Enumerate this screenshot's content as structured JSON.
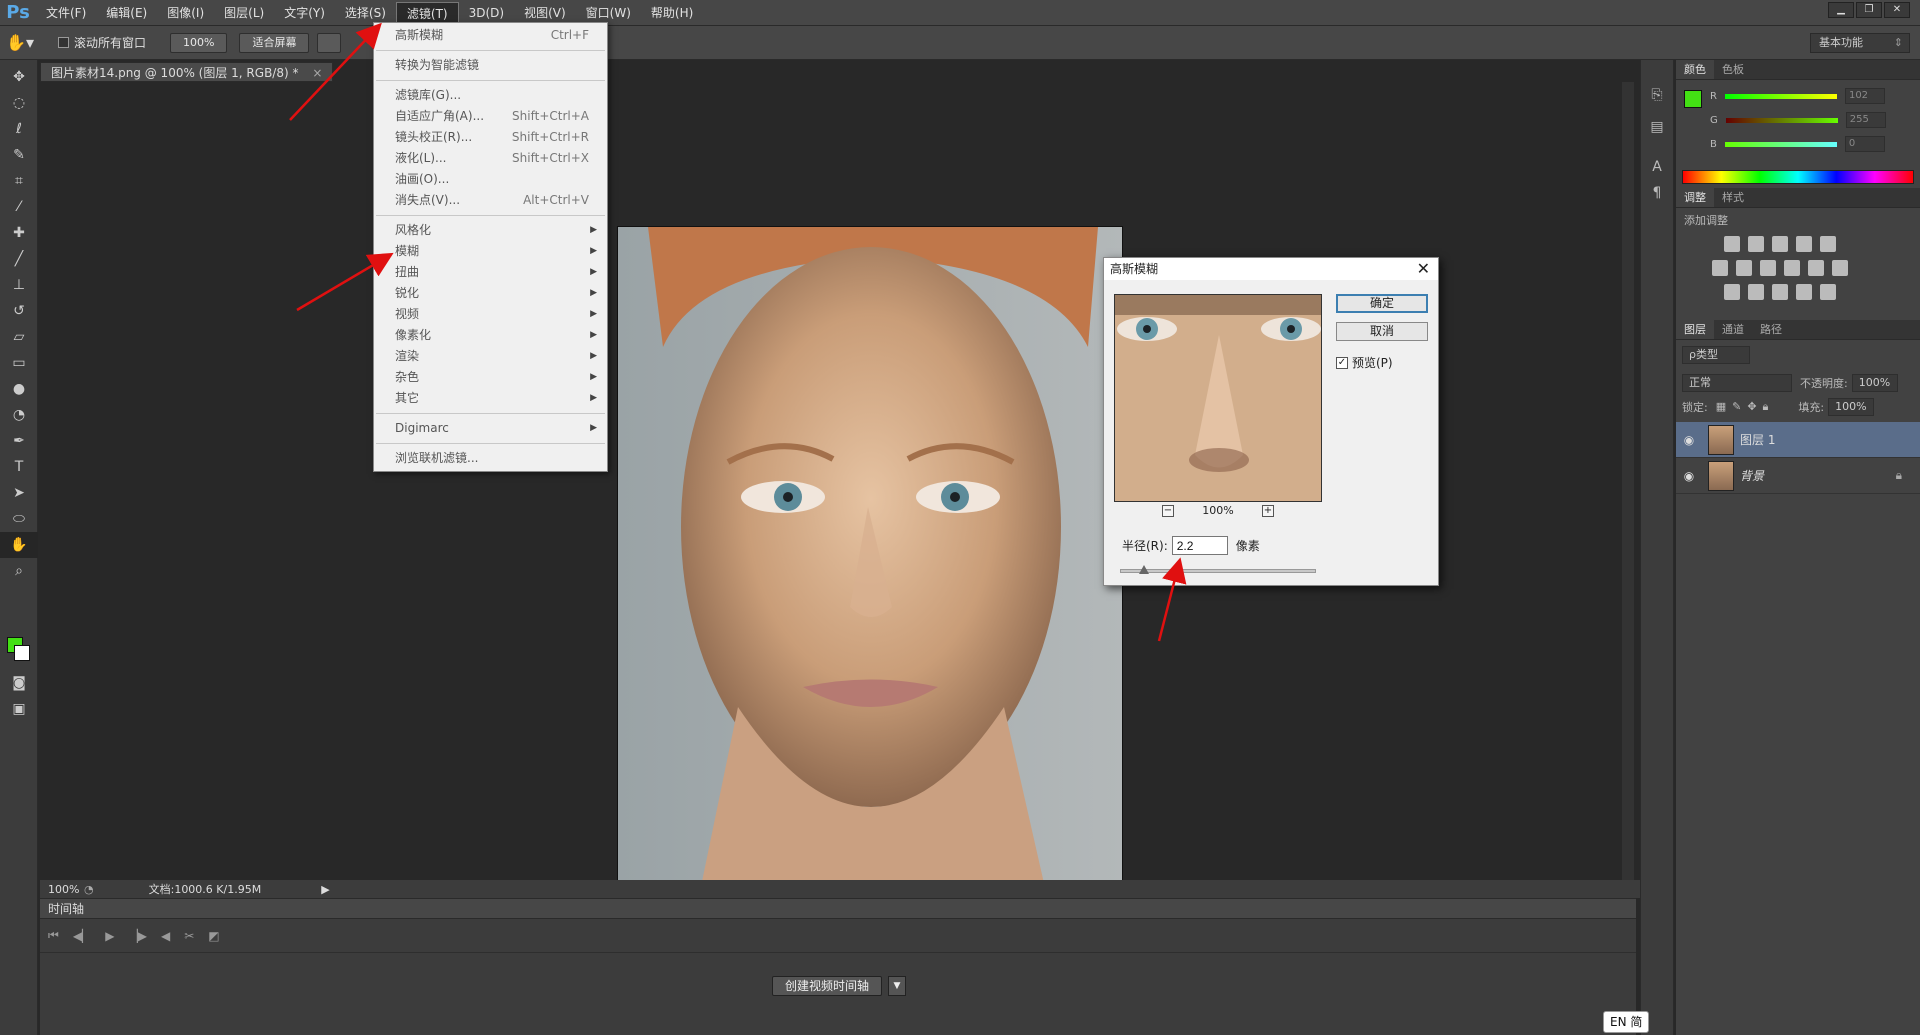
{
  "app": {
    "logo": "Ps"
  },
  "menubar": [
    "文件(F)",
    "编辑(E)",
    "图像(I)",
    "图层(L)",
    "文字(Y)",
    "选择(S)",
    "滤镜(T)",
    "3D(D)",
    "视图(V)",
    "窗口(W)",
    "帮助(H)"
  ],
  "options": {
    "scroll_all": "滚动所有窗口",
    "zoom": "100%",
    "fit_screen": "适合屏幕",
    "workspace": "基本功能"
  },
  "document": {
    "tab_title": "图片素材14.png @ 100% (图层 1, RGB/8) *",
    "status_zoom": "100%",
    "status_doc": "文档:1000.6 K/1.95M"
  },
  "filter_menu": {
    "items": [
      {
        "label": "高斯模糊",
        "shortcut": "Ctrl+F"
      },
      {
        "sep": true
      },
      {
        "label": "转换为智能滤镜"
      },
      {
        "sep": true
      },
      {
        "label": "滤镜库(G)..."
      },
      {
        "label": "自适应广角(A)...",
        "shortcut": "Shift+Ctrl+A"
      },
      {
        "label": "镜头校正(R)...",
        "shortcut": "Shift+Ctrl+R"
      },
      {
        "label": "液化(L)...",
        "shortcut": "Shift+Ctrl+X"
      },
      {
        "label": "油画(O)..."
      },
      {
        "label": "消失点(V)...",
        "shortcut": "Alt+Ctrl+V"
      },
      {
        "sep": true
      },
      {
        "label": "风格化",
        "submenu": true
      },
      {
        "label": "模糊",
        "submenu": true
      },
      {
        "label": "扭曲",
        "submenu": true
      },
      {
        "label": "锐化",
        "submenu": true
      },
      {
        "label": "视频",
        "submenu": true
      },
      {
        "label": "像素化",
        "submenu": true
      },
      {
        "label": "渲染",
        "submenu": true
      },
      {
        "label": "杂色",
        "submenu": true
      },
      {
        "label": "其它",
        "submenu": true
      },
      {
        "sep": true
      },
      {
        "label": "Digimarc",
        "submenu": true
      },
      {
        "sep": true
      },
      {
        "label": "浏览联机滤镜..."
      }
    ]
  },
  "gauss_dialog": {
    "title": "高斯模糊",
    "ok": "确定",
    "cancel": "取消",
    "preview_label": "预览(P)",
    "preview_checked": true,
    "zoom": "100%",
    "radius_label": "半径(R):",
    "radius_value": "2.2",
    "radius_unit": "像素"
  },
  "timeline": {
    "title": "时间轴",
    "create_button": "创建视频时间轴"
  },
  "panels": {
    "color_tabs": [
      "颜色",
      "色板"
    ],
    "color": {
      "R": "102",
      "G": "255",
      "B": "0",
      "r_label": "R",
      "g_label": "G",
      "b_label": "B"
    },
    "adjust_tabs": [
      "调整",
      "样式"
    ],
    "adjust_label": "添加调整",
    "layers_tabs": [
      "图层",
      "通道",
      "路径"
    ],
    "layer_kind": "ρ类型",
    "blend_mode": "正常",
    "opacity_label": "不透明度:",
    "opacity_value": "100%",
    "lock_label": "锁定:",
    "fill_label": "填充:",
    "fill_value": "100%",
    "layers": [
      {
        "name": "图层 1",
        "selected": true
      },
      {
        "name": "背景",
        "selected": false,
        "locked": true
      }
    ]
  },
  "ime": "EN 简",
  "colors": {
    "foreground": "#43e014",
    "background": "#ffffff",
    "accent": "#3c7fb1"
  }
}
